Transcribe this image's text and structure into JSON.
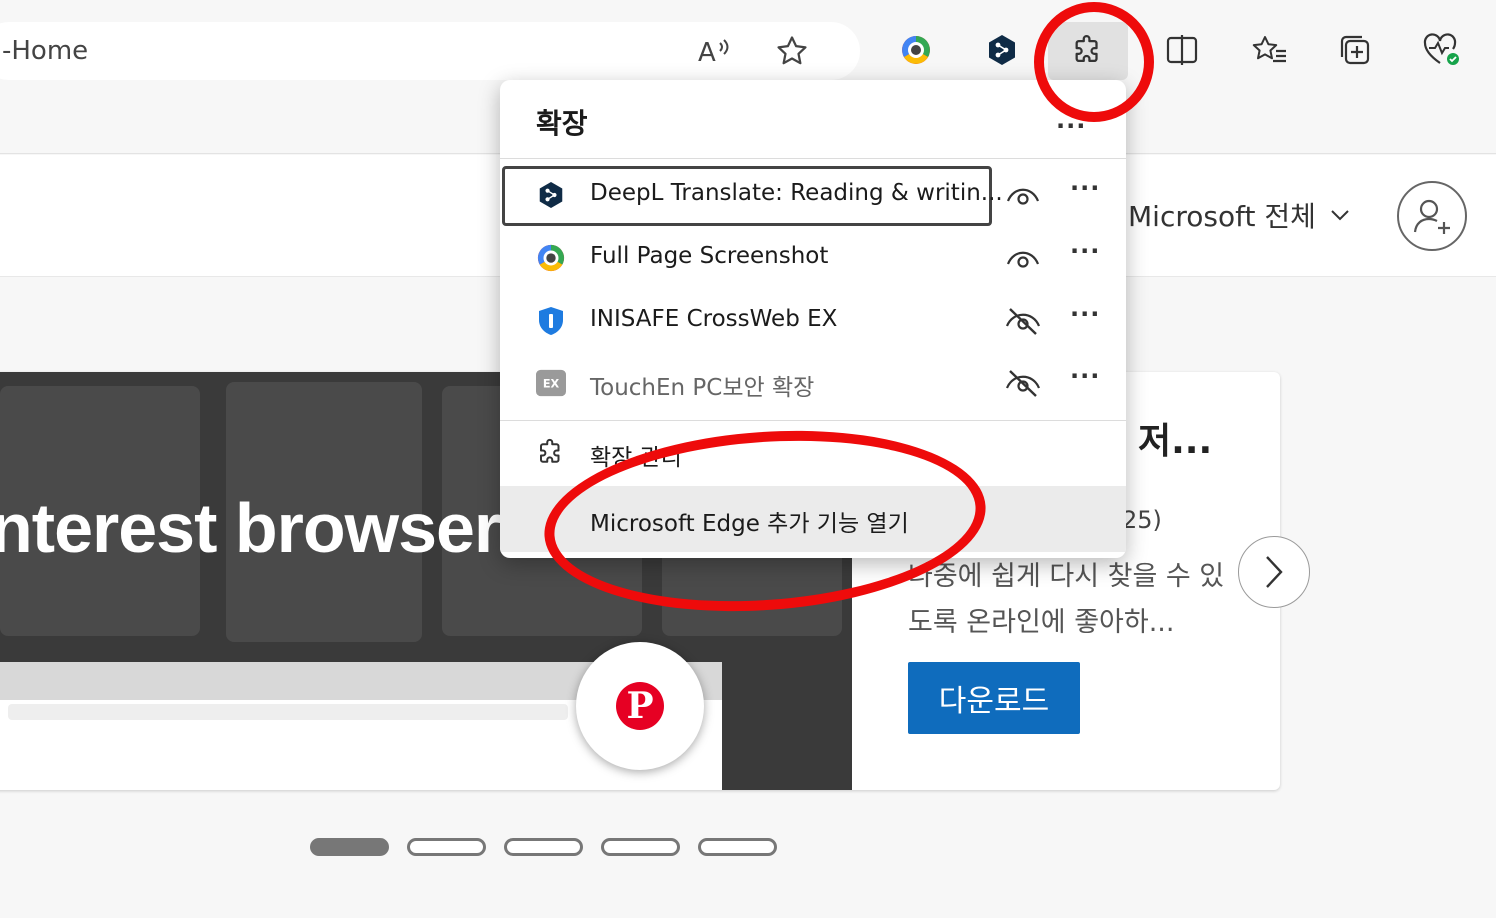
{
  "toolbar": {
    "address_text": "-Home",
    "icons": [
      "read-aloud-icon",
      "favorite-star-icon",
      "full-page-screenshot-icon",
      "deepl-icon",
      "extensions-puzzle-icon",
      "split-screen-icon",
      "favorites-icon",
      "collections-icon",
      "browser-essentials-icon"
    ]
  },
  "header": {
    "ms_all_label": "Microsoft 전체"
  },
  "promo": {
    "hero_title": "nterest browser",
    "heading": "저...",
    "subtext": "25)",
    "description": "나중에 쉽게 다시 찾을 수 있도록 온라인에 좋아하...",
    "download_label": "다운로드",
    "pager_count": 5,
    "pager_active": 1
  },
  "extensions_menu": {
    "title": "확장",
    "more_label": "...",
    "items": [
      {
        "name": "DeepL Translate: Reading & writin...",
        "visible_in_toolbar": true,
        "focused": true,
        "logo": "deepl-icon",
        "more": "···"
      },
      {
        "name": "Full Page Screenshot",
        "visible_in_toolbar": true,
        "focused": false,
        "logo": "camera-lens-icon",
        "more": "···"
      },
      {
        "name": "INISAFE CrossWeb EX",
        "visible_in_toolbar": false,
        "focused": false,
        "logo": "shield-icon",
        "more": "···"
      },
      {
        "name": "TouchEn PC보안 확장",
        "visible_in_toolbar": false,
        "focused": false,
        "logo": "ex-badge-icon",
        "logo_text": "EX",
        "more": "···"
      }
    ],
    "manage_label": "확장 관리",
    "addons_label": "Microsoft Edge 추가 기능 열기"
  },
  "colors": {
    "accent": "#0f6cbd",
    "annotation": "#ee0b0b",
    "hero_bg": "#3a3a3a",
    "pinterest": "#e60023"
  }
}
